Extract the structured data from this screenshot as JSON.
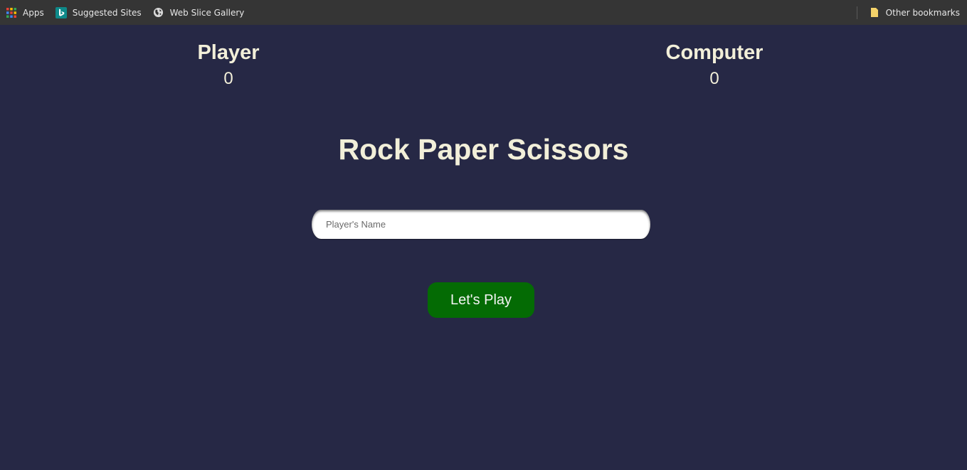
{
  "bookmarks": {
    "items": [
      {
        "label": "Apps",
        "icon": "apps-grid-icon"
      },
      {
        "label": "Suggested Sites",
        "icon": "bing-icon"
      },
      {
        "label": "Web Slice Gallery",
        "icon": "globe-icon"
      }
    ],
    "other": {
      "label": "Other bookmarks",
      "icon": "folder-icon"
    }
  },
  "scoreboard": {
    "player": {
      "label": "Player",
      "score": "0"
    },
    "computer": {
      "label": "Computer",
      "score": "0"
    }
  },
  "game": {
    "title": "Rock Paper Scissors",
    "name_input": {
      "placeholder": "Player's Name",
      "value": ""
    },
    "play_label": "Let's Play"
  },
  "colors": {
    "background": "#262845",
    "text": "#f2efd9",
    "button": "#046b04",
    "bookmarks_bar": "#353535"
  }
}
